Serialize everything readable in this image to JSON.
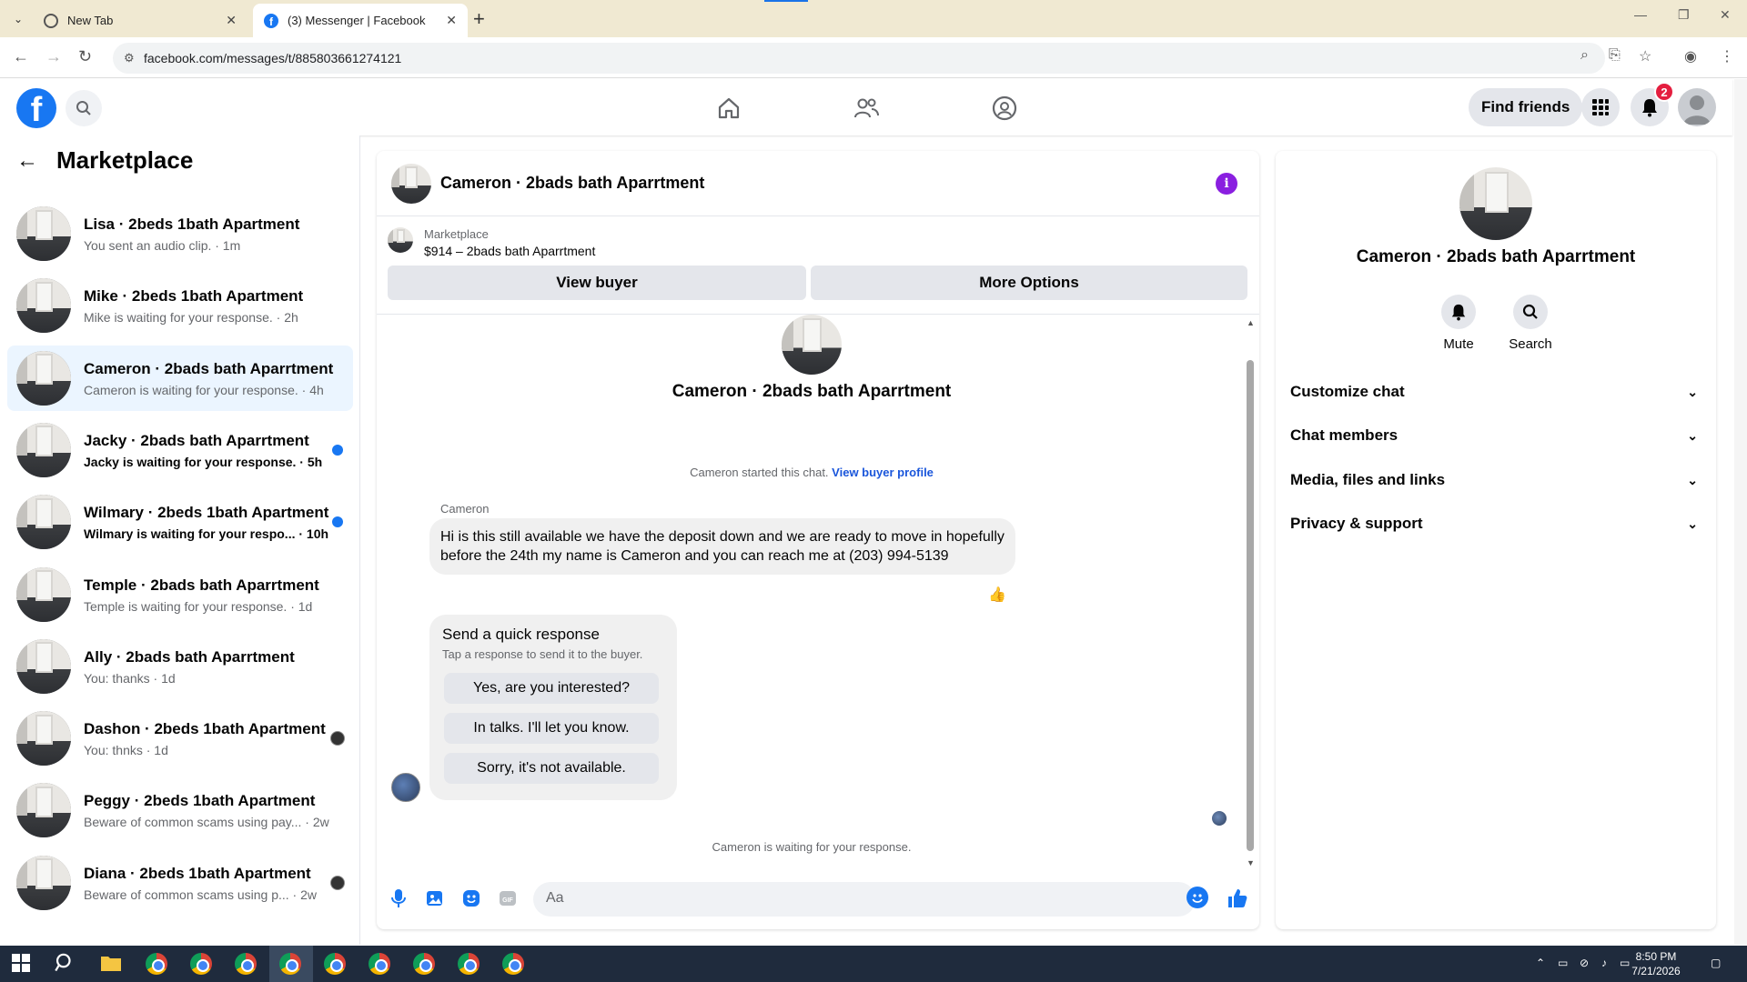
{
  "browser": {
    "tabs": [
      {
        "title": "New Tab",
        "active": false
      },
      {
        "title": "(3) Messenger | Facebook",
        "active": true
      }
    ],
    "url": "facebook.com/messages/t/885803661274121"
  },
  "fbnav": {
    "logo": "f",
    "find_friends": "Find friends",
    "notif_count": "2"
  },
  "sidebar": {
    "title": "Marketplace",
    "conversations": [
      {
        "name": "Lisa · 2beds 1bath Apartment",
        "preview": "You sent an audio clip. · 1m",
        "unread": false,
        "active": false
      },
      {
        "name": "Mike · 2beds 1bath Apartment",
        "preview": "Mike is waiting for your response. · 2h",
        "unread": false,
        "active": false
      },
      {
        "name": "Cameron · 2bads bath Aparrtment",
        "preview": "Cameron is waiting for your response. · 4h",
        "unread": false,
        "active": true
      },
      {
        "name": "Jacky · 2bads bath Aparrtment",
        "preview": "Jacky is waiting for your response. · 5h",
        "unread": true,
        "active": false
      },
      {
        "name": "Wilmary · 2beds 1bath Apartment",
        "preview": "Wilmary is waiting for your respo... · 10h",
        "unread": true,
        "active": false
      },
      {
        "name": "Temple · 2bads bath Aparrtment",
        "preview": "Temple is waiting for your response. · 1d",
        "unread": false,
        "active": false
      },
      {
        "name": "Ally · 2bads bath Aparrtment",
        "preview": "You: thanks · 1d",
        "unread": false,
        "active": false
      },
      {
        "name": "Dashon · 2beds 1bath Apartment",
        "preview": "You: thnks · 1d",
        "unread": false,
        "active": false
      },
      {
        "name": "Peggy · 2beds 1bath Apartment",
        "preview": "Beware of common scams using pay... · 2w",
        "unread": false,
        "active": false
      },
      {
        "name": "Diana · 2beds 1bath Apartment",
        "preview": "Beware of common scams using p... · 2w",
        "unread": false,
        "active": false
      }
    ]
  },
  "chat": {
    "title": "Cameron · 2bads bath Aparrtment",
    "marketplace_label": "Marketplace",
    "listing": "$914 – 2bads bath Aparrtment",
    "view_buyer": "View buyer",
    "more_options": "More Options",
    "hero_name": "Cameron · 2bads bath Aparrtment",
    "started_text": "Cameron started this chat.",
    "view_buyer_profile": "View buyer profile",
    "sender": "Cameron",
    "message": "Hi is this still available we have the deposit down and we are ready to move in hopefully before the 24th my name is Cameron and you can reach me at (203) 994-5139",
    "reaction": "👍",
    "quick_title": "Send a quick response",
    "quick_sub": "Tap a response to send it to the buyer.",
    "quick_replies": [
      "Yes, are you interested?",
      "In talks. I'll let you know.",
      "Sorry, it's not available."
    ],
    "waiting": "Cameron is waiting for your response.",
    "composer_placeholder": "Aa"
  },
  "right_panel": {
    "name": "Cameron · 2bads bath Aparrtment",
    "mute": "Mute",
    "search": "Search",
    "sections": [
      "Customize chat",
      "Chat members",
      "Media, files and links",
      "Privacy & support"
    ]
  },
  "taskbar": {
    "time": "8:50 PM",
    "date": "7/21/2026"
  },
  "colors": {
    "accent": "#1877f2",
    "active_conv_bg": "#ebf5ff",
    "info": "#8a1fe0",
    "badge": "#e41e3f"
  }
}
